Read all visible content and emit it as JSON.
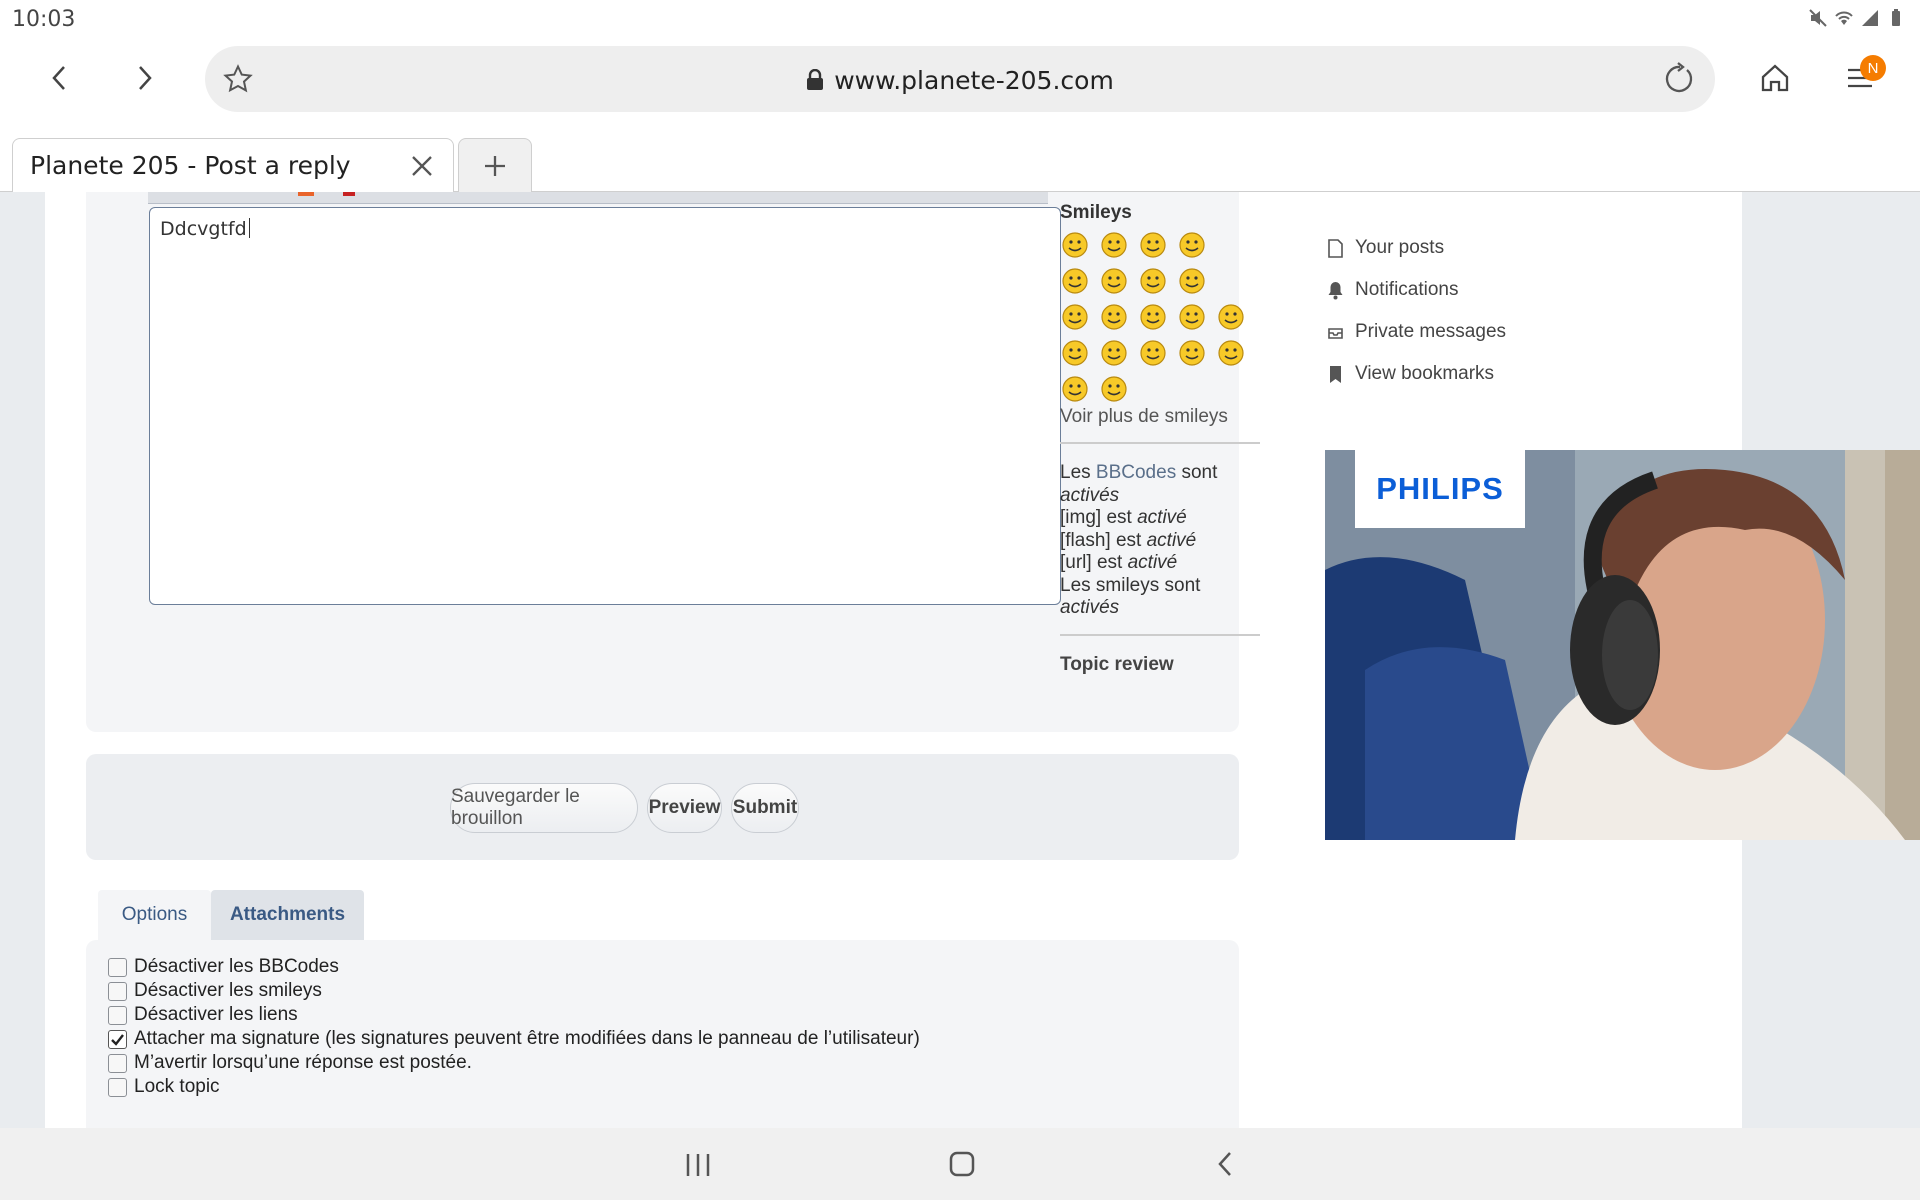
{
  "status_bar": {
    "time": "10:03"
  },
  "browser": {
    "url": "www.planete-205.com",
    "tab_title": "Planete 205 - Post a reply",
    "menu_badge": "N"
  },
  "editor": {
    "message_text": "Ddcvgtfd"
  },
  "smileys": {
    "title": "Smileys",
    "more_link": "Voir plus de smileys"
  },
  "bbcode_info": {
    "les": "Les",
    "bbcodes_link": "BBCodes",
    "sont": "sont",
    "actives": "activés",
    "img": "[img] est",
    "flash": "[flash] est",
    "url": "[url] est",
    "active": "activé",
    "smileys": "Les smileys sont"
  },
  "topic_review": "Topic review",
  "buttons": {
    "save_draft": "Sauvegarder le brouillon",
    "preview": "Preview",
    "submit": "Submit"
  },
  "tabs": {
    "options": "Options",
    "attachments": "Attachments"
  },
  "options": [
    {
      "label": "Désactiver les BBCodes",
      "checked": false
    },
    {
      "label": "Désactiver les smileys",
      "checked": false
    },
    {
      "label": "Désactiver les liens",
      "checked": false
    },
    {
      "label": "Attacher ma signature (les signatures peuvent être modifiées dans le panneau de l’utilisateur)",
      "checked": true
    },
    {
      "label": "M’avertir lorsqu’une réponse est postée.",
      "checked": false
    },
    {
      "label": "Lock topic",
      "checked": false
    }
  ],
  "user_menu": {
    "your_posts": "Your posts",
    "notifications": "Notifications",
    "private_messages": "Private messages",
    "view_bookmarks": "View bookmarks"
  },
  "ad": {
    "brand": "PHILIPS"
  },
  "colors": {
    "badge": "#f57c00",
    "link": "#5a6f8a",
    "tab_text": "#3a5a84"
  }
}
